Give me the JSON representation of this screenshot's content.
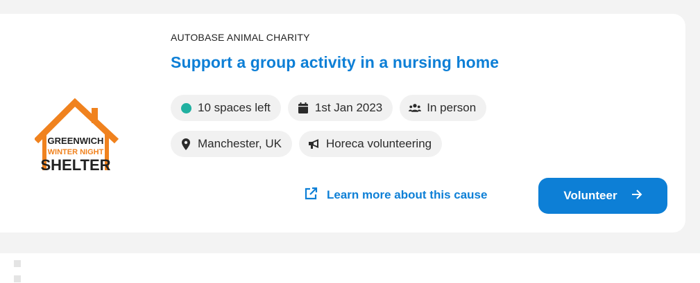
{
  "opportunity": {
    "organization": "AUTOBASE ANIMAL CHARITY",
    "title": "Support a group activity in a nursing home",
    "logo": {
      "line1": "GREENWICH",
      "line2": "WINTER NIGHT",
      "line3": "SHELTER",
      "roof_color": "#f0821e",
      "line2_color": "#f0821e",
      "text_color": "#222222"
    },
    "chips_row1": [
      {
        "icon": "status-dot",
        "label": "10 spaces left"
      },
      {
        "icon": "calendar-icon",
        "label": "1st Jan 2023"
      },
      {
        "icon": "people-icon",
        "label": "In person"
      }
    ],
    "chips_row2": [
      {
        "icon": "location-pin-icon",
        "label": "Manchester, UK"
      },
      {
        "icon": "megaphone-icon",
        "label": "Horeca volunteering"
      }
    ],
    "learn_more_label": "Learn more about this cause",
    "volunteer_label": "Volunteer"
  },
  "colors": {
    "accent": "#0d7fd6",
    "status_dot": "#20b0a0",
    "chip_bg": "#f1f1f1"
  }
}
